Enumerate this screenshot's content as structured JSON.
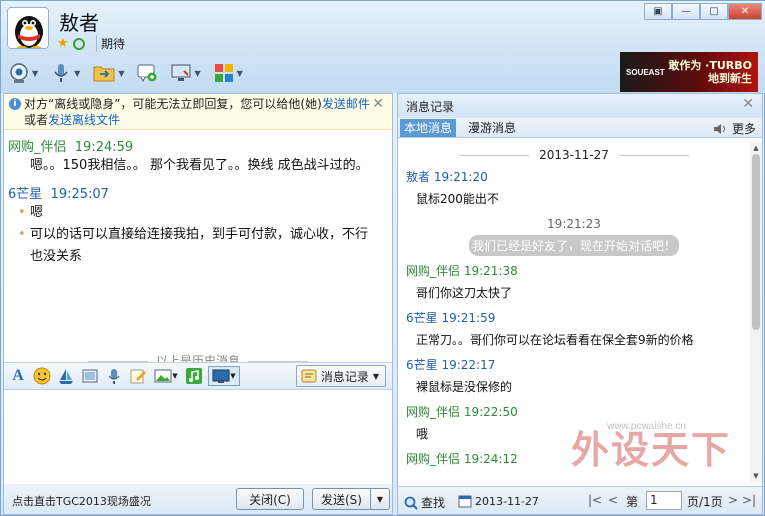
{
  "header": {
    "contact_name": "敖者",
    "signature": "期待"
  },
  "ad": {
    "logo": "SOUEAST",
    "text": "敢作为 ·TURBO 地到新生"
  },
  "notice": {
    "text_1": "对方“离线或隐身”，可能无法立即回复，您可以给他(她)",
    "link_1": "发送邮件",
    "text_2": "或者",
    "link_2": "发送离线文件"
  },
  "chat": {
    "messages": [
      {
        "sender": "网购_伴侣",
        "time": "19:24:59",
        "color": "green",
        "lines": [
          "嗯。。150我相信。。 那个我看见了。。换线 成色战斗过的。"
        ]
      },
      {
        "sender": "6芒星",
        "time": "19:25:07",
        "color": "blue",
        "lines": [
          "嗯",
          "可以的话可以直接给连接我拍，到手可付款，诚心收，不行也没关系"
        ]
      }
    ],
    "history_separator": "以上是历史消息"
  },
  "input_toolbar": {
    "history_button": "消息记录"
  },
  "bottom": {
    "promo_link": "点击直击TGC2013现场盛况",
    "close_button": "关闭(C)",
    "send_button": "发送(S)"
  },
  "history": {
    "title": "消息记录",
    "tabs": [
      "本地消息",
      "漫游消息"
    ],
    "more_label": "更多",
    "date": "2013-11-27",
    "entries": [
      {
        "kind": "msg",
        "sender": "敖者",
        "time": "19:21:20",
        "color": "blue",
        "text": "鼠标200能出不"
      },
      {
        "kind": "sys",
        "time": "19:21:23",
        "text": "我们已经是好友了，现在开始对话吧！"
      },
      {
        "kind": "msg",
        "sender": "网购_伴侣",
        "time": "19:21:38",
        "color": "green",
        "text": "哥们你这刀太快了"
      },
      {
        "kind": "msg",
        "sender": "6芒星",
        "time": "19:21:59",
        "color": "blue",
        "text": "正常刀。。哥们你可以在论坛看看在保全套9新的价格"
      },
      {
        "kind": "msg",
        "sender": "6芒星",
        "time": "19:22:17",
        "color": "blue",
        "text": "裸鼠标是没保修的"
      },
      {
        "kind": "msg",
        "sender": "网购_伴侣",
        "time": "19:22:50",
        "color": "green",
        "text": "哦"
      },
      {
        "kind": "msg",
        "sender": "网购_伴侣",
        "time": "19:24:12",
        "color": "green",
        "text": ""
      }
    ],
    "footer": {
      "search_label": "查找",
      "date_value": "2013-11-27",
      "page_prefix": "第",
      "page_value": "1",
      "page_suffix": "页/1页"
    }
  },
  "watermark": {
    "text": "外设天下",
    "url": "www.pcwaishe.cn"
  }
}
